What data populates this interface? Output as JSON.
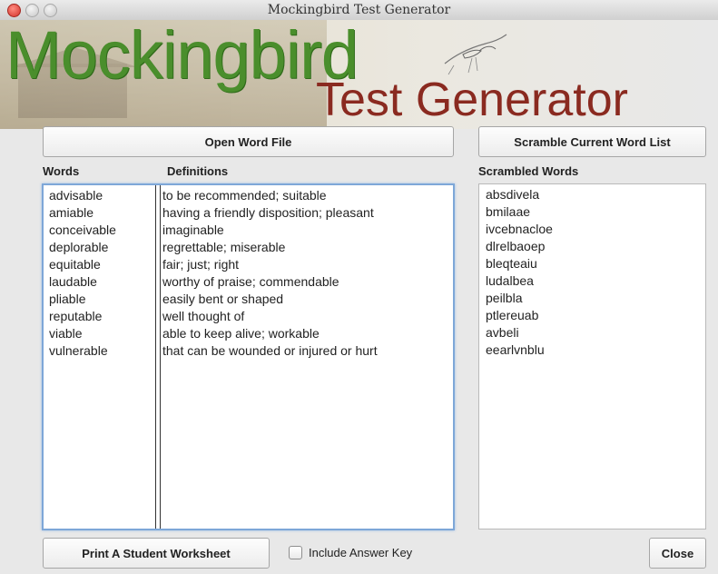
{
  "window": {
    "title": "Mockingbird Test Generator"
  },
  "banner": {
    "logo_main": "Mockingbird",
    "logo_sub": "Test Generator"
  },
  "toolbar": {
    "open_label": "Open Word File",
    "scramble_label": "Scramble Current Word List",
    "print_label": "Print A Student Worksheet",
    "close_label": "Close"
  },
  "headers": {
    "words": "Words",
    "definitions": "Definitions",
    "scrambled": "Scrambled Words"
  },
  "entries": [
    {
      "word": "advisable",
      "definition": "to be recommended; suitable",
      "scrambled": "absdivela"
    },
    {
      "word": "amiable",
      "definition": "having a friendly disposition; pleasant",
      "scrambled": "bmilaae"
    },
    {
      "word": "conceivable",
      "definition": "imaginable",
      "scrambled": "ivcebnacloe"
    },
    {
      "word": "deplorable",
      "definition": "regrettable; miserable",
      "scrambled": "dlrelbaoep"
    },
    {
      "word": "equitable",
      "definition": "fair; just; right",
      "scrambled": "bleqteaiu"
    },
    {
      "word": "laudable",
      "definition": "worthy of praise; commendable",
      "scrambled": "ludalbea"
    },
    {
      "word": "pliable",
      "definition": "easily bent or shaped",
      "scrambled": "peilbla"
    },
    {
      "word": "reputable",
      "definition": "well thought of",
      "scrambled": "ptlereuab"
    },
    {
      "word": "viable",
      "definition": "able to keep alive; workable",
      "scrambled": "avbeli"
    },
    {
      "word": "vulnerable",
      "definition": "that can be wounded or injured or hurt",
      "scrambled": "eearlvnblu"
    }
  ],
  "answer_key": {
    "label": "Include Answer Key",
    "checked": false
  },
  "colors": {
    "logo_green": "#4a8e2c",
    "logo_red": "#8a2a20",
    "focus_ring": "#7ea7d8"
  }
}
